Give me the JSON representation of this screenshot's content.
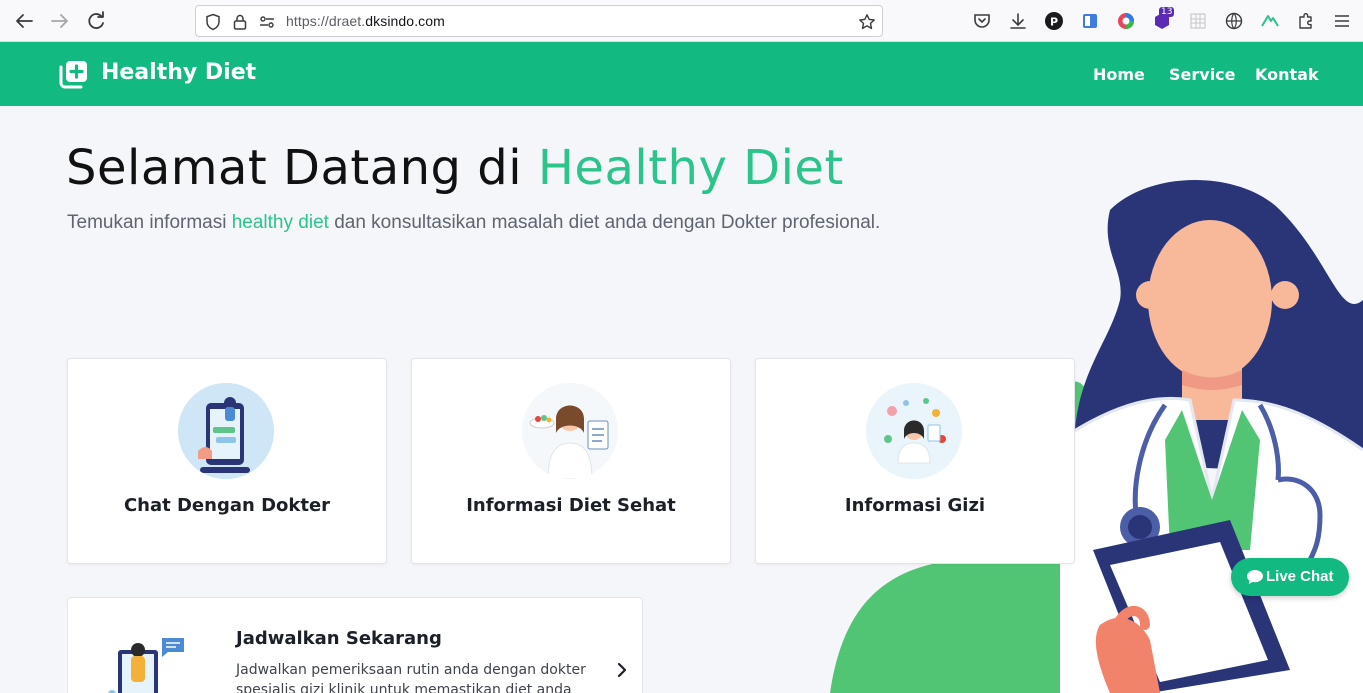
{
  "browser": {
    "url_prefix": "https://draet.",
    "url_domain": "dksindo.com",
    "extension_badge": "13"
  },
  "header": {
    "brand": "Healthy Diet",
    "menu": [
      "Home",
      "Service",
      "Kontak"
    ]
  },
  "hero": {
    "title_plain": "Selamat Datang di ",
    "title_accent": "Healthy Diet",
    "sub_before": "Temukan informasi ",
    "sub_accent": "healthy diet",
    "sub_after": " dan konsultasikan masalah diet anda dengan Dokter profesional."
  },
  "cards": [
    {
      "label": "Chat Dengan Dokter",
      "icon": "doctor-chat-phone-illustration"
    },
    {
      "label": "Informasi Diet Sehat",
      "icon": "doctor-with-food-illustration"
    },
    {
      "label": "Informasi Gizi",
      "icon": "nutrition-doctor-illustration"
    }
  ],
  "schedule": {
    "title": "Jadwalkan Sekarang",
    "text": "Jadwalkan pemeriksaan rutin anda dengan dokter spesialis gizi klinik untuk memastikan diet anda tetap"
  },
  "live_chat": {
    "label": "Live Chat"
  },
  "colors": {
    "brand": "#12b981",
    "accent": "#2bc48a"
  }
}
